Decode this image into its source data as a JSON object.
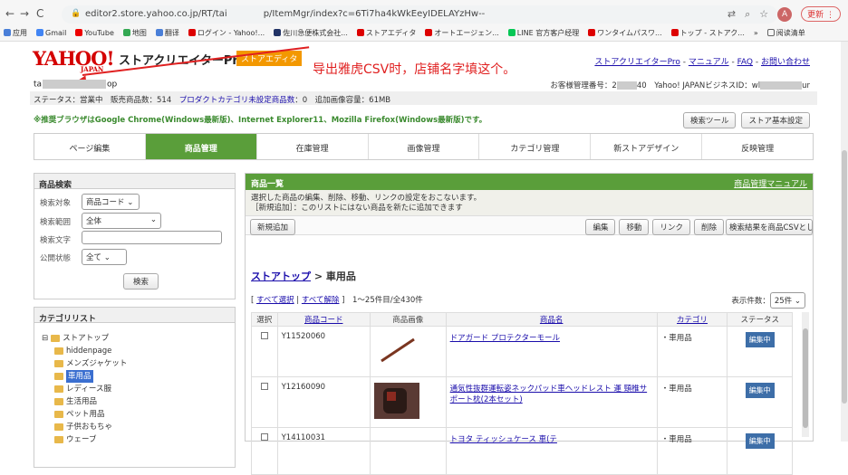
{
  "browser": {
    "url": "editor2.store.yahoo.co.jp/RT/tai    p/ItemMgr/index?c=6Ti7ha4kWkEeyIDELAYzHw--",
    "update_label": "更新",
    "avatar_letter": "A",
    "bookmarks": [
      "应用",
      "Gmail",
      "YouTube",
      "地图",
      "翻译",
      "ログイン - Yahoo!...",
      "佐川急便株式会社...",
      "ストアエディタ",
      "オートエージェン...",
      "LINE 官方客户经理",
      "ワンタイムパスワ...",
      "トップ - ストアク...",
      "»",
      "阅读清单"
    ]
  },
  "header": {
    "logo": "YAHOO!",
    "logo_sub": "JAPAN",
    "app_title": "ストアクリエイターPro",
    "editor_badge": "ストアエディタ",
    "annotation": "导出雅虎CSV时，店铺名字填这个。",
    "links": [
      "ストアクリエイターPro",
      "マニュアル",
      "FAQ",
      "お問い合わせ"
    ],
    "store_prefix": "ta",
    "store_suffix": "op",
    "account_label": "お客様管理番号：2",
    "account_mid": "40",
    "business_label": "Yahoo! JAPANビジネスID：wl",
    "business_end": "ur"
  },
  "status": {
    "text1": "ステータス：営業中　販売商品数：514　",
    "link": "プロダクトカテゴリ未設定商品数",
    "text2": "：0　追加画像容量：61MB"
  },
  "notice": "※推奨ブラウザはGoogle Chrome(Windows最新版)、Internet Explorer11、Mozilla Firefox(Windows最新版)です。",
  "top_buttons": [
    "検索ツール",
    "ストア基本設定"
  ],
  "tabs": [
    "ページ編集",
    "商品管理",
    "在庫管理",
    "画像管理",
    "カテゴリ管理",
    "新ストアデザイン",
    "反映管理"
  ],
  "search_panel": {
    "title": "商品検索",
    "target_label": "検索対象",
    "target_value": "商品コード",
    "range_label": "検索範囲",
    "range_value": "全体",
    "text_label": "検索文字",
    "public_label": "公開状態",
    "public_value": "全て",
    "search_button": "検索"
  },
  "category_panel": {
    "title": "カテゴリリスト",
    "items": [
      "ストアトップ",
      "hiddenpage",
      "メンズジャケット",
      "車用品",
      "レディース服",
      "生活用品",
      "ペット用品",
      "子供おもちゃ",
      "ウェーブ"
    ]
  },
  "product_list": {
    "title": "商品一覧",
    "manual_link": "商品管理マニュアル",
    "desc1": "選択した商品の編集、削除、移動、リンクの設定をおこないます。",
    "desc2": "［新規追加］：このリストにはない商品を新たに追加できます",
    "add_button": "新規追加",
    "actions": [
      "編集",
      "移動",
      "リンク",
      "削除",
      "検索結果を商品CSVとしてダウンロード"
    ],
    "breadcrumb_link": "ストアトップ",
    "breadcrumb_current": " > 車用品",
    "select_all": "すべて選択",
    "deselect_all": "すべて解除",
    "count_text": "1〜25件目/全430件",
    "per_page_label": "表示件数：",
    "per_page_value": "25件",
    "columns": [
      "選択",
      "商品コード",
      "商品画像",
      "商品名",
      "カテゴリ",
      "ステータス"
    ],
    "rows": [
      {
        "code": "Y11520060",
        "name": "ドアガード プロテクターモール",
        "category": "・車用品",
        "status": "編集中"
      },
      {
        "code": "Y12160090",
        "name": "通気性抜群運転姿ネックパッド車ヘッドレスト 運 頸椎サポート枕(2本セット)",
        "category": "・車用品",
        "status": "編集中"
      },
      {
        "code": "Y14110031",
        "name": "トヨタ ティッシュケース 車(テ",
        "category": "・車用品",
        "status": "編集中"
      }
    ]
  }
}
